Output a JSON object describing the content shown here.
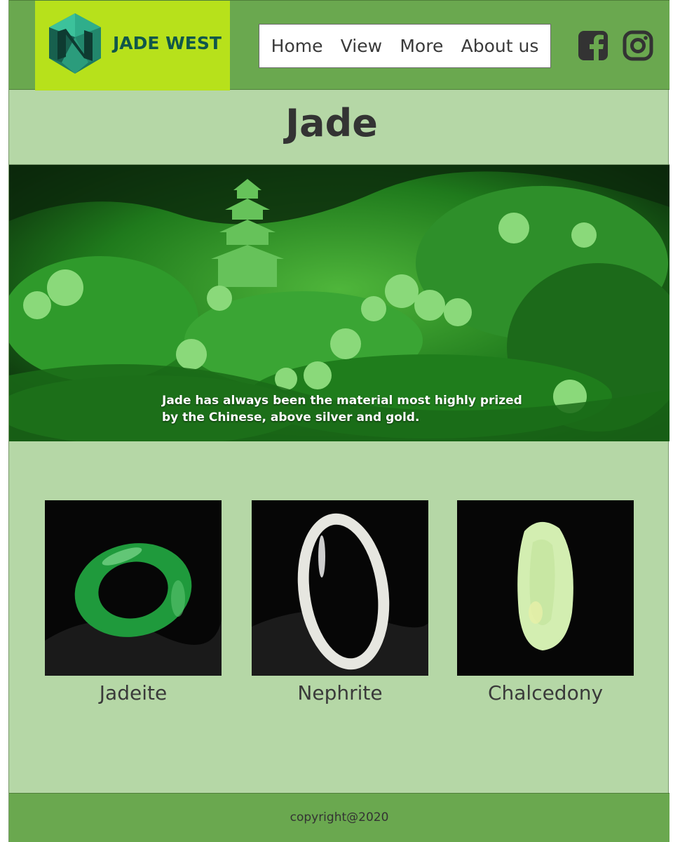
{
  "brand": {
    "name": "JADE WEST",
    "colors": {
      "header": "#6aa84f",
      "logo_bg": "#b7e11b",
      "page_bg": "#b5d7a6",
      "brand_text": "#10574a"
    }
  },
  "nav": {
    "items": [
      {
        "label": "Home"
      },
      {
        "label": "View"
      },
      {
        "label": "More"
      },
      {
        "label": "About us"
      }
    ]
  },
  "social": {
    "icons": [
      "facebook-icon",
      "instagram-icon"
    ]
  },
  "page": {
    "title": "Jade"
  },
  "hero": {
    "caption": "Jade has always been the material most highly prized by the Chinese, above silver and gold."
  },
  "products": [
    {
      "name": "Jadeite"
    },
    {
      "name": "Nephrite"
    },
    {
      "name": "Chalcedony"
    }
  ],
  "footer": {
    "copyright": "copyright@2020"
  }
}
